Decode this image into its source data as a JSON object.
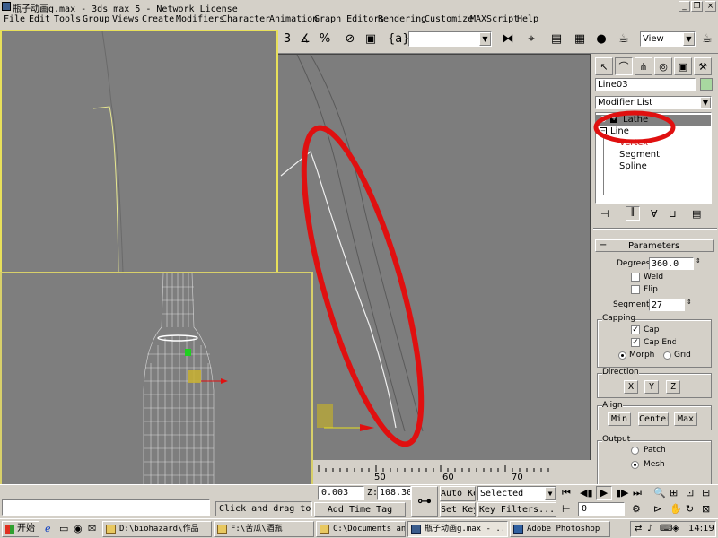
{
  "window": {
    "title": "瓶子动画g.max - 3ds max 5 - Network License",
    "buttons": [
      "_",
      "❐",
      "×"
    ]
  },
  "menu": [
    "File",
    "Edit",
    "Tools",
    "Group",
    "Views",
    "Create",
    "Modifiers",
    "Character",
    "Animation",
    "Graph Editors",
    "Rendering",
    "Customize",
    "MAXScript",
    "Help"
  ],
  "toolbar": {
    "view_dropdown": "View",
    "selection_set": ""
  },
  "command_panel": {
    "object_name": "Line03",
    "modifier_list": "Modifier List",
    "stack": [
      {
        "label": "Lathe",
        "expanded": false
      },
      {
        "label": "Line",
        "expanded": true
      },
      {
        "label": "Vertex"
      },
      {
        "label": "Segment"
      },
      {
        "label": "Spline"
      }
    ],
    "rollout_title": "Parameters",
    "degrees_label": "Degrees:",
    "degrees_value": "360.0",
    "weld_label": "Weld",
    "flip_label": "Flip",
    "segments_label": "Segments:",
    "segments_value": "27",
    "capping_title": "Capping",
    "cap_start": "Cap",
    "cap_end": "Cap End",
    "morph": "Morph",
    "grid": "Grid",
    "direction_title": "Direction",
    "dir_x": "X",
    "dir_y": "Y",
    "dir_z": "Z",
    "align_title": "Align",
    "align_min": "Min",
    "align_center": "Center",
    "align_max": "Max",
    "output_title": "Output",
    "patch": "Patch",
    "mesh": "Mesh"
  },
  "timeline": {
    "ticks": [
      "50",
      "60",
      "70"
    ]
  },
  "status": {
    "prompt": "Click and drag to select",
    "x_value": "0.003",
    "z_label": "Z:",
    "z_value": "108.30",
    "add_time_tag": "Add Time Tag",
    "auto_key": "Auto Key",
    "set_key": "Set Key",
    "selected": "Selected",
    "key_filters": "Key Filters...",
    "frame": "0"
  },
  "taskbar": {
    "start": "开始",
    "tasks": [
      "D:\\biohazard\\作品",
      "F:\\苦瓜\\酒瓶",
      "C:\\Documents and...",
      "瓶子动画g.max - ...",
      "Adobe Photoshop"
    ],
    "clock": "14:19"
  },
  "colors": {
    "annotation_red": "#e01010",
    "viewport_gray": "#7e7e7e",
    "active_border": "#e8e05a"
  }
}
